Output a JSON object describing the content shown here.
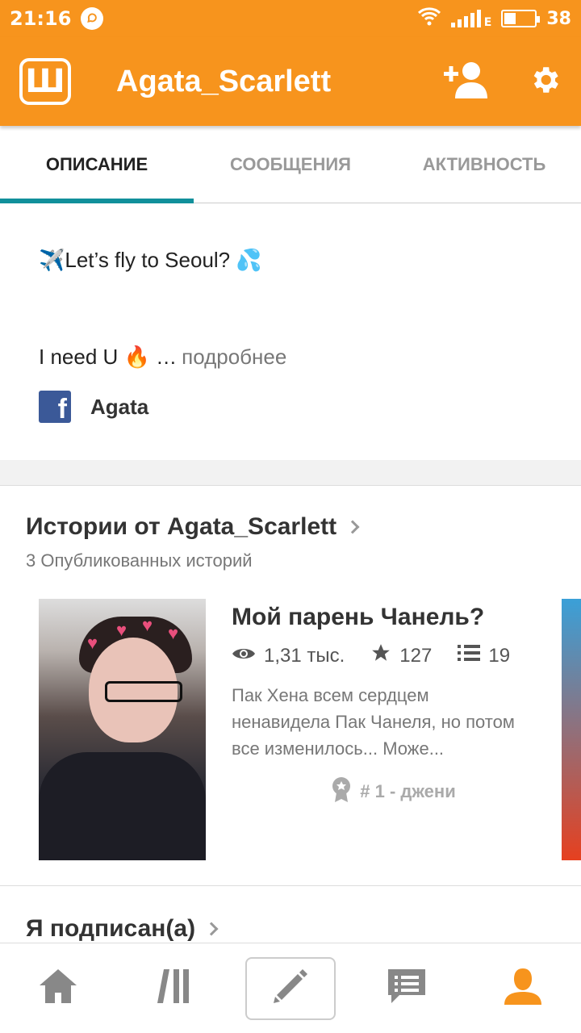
{
  "status": {
    "time": "21:16",
    "battery": "38",
    "network": "E",
    "battery_level": 0.38
  },
  "header": {
    "title": "Agata_Scarlett",
    "logo_letter": "Ш",
    "icons": [
      "add-user-icon",
      "gear-icon"
    ]
  },
  "tabs": [
    {
      "label": "ОПИСАНИЕ",
      "active": true
    },
    {
      "label": "СООБЩЕНИЯ",
      "active": false
    },
    {
      "label": "АКТИВНОСТЬ",
      "active": false
    }
  ],
  "about": {
    "line1": "✈️Let’s fly to Seoul? 💦",
    "line2": "I need U 🔥 …",
    "more": "подробнее",
    "facebook_letter": "f",
    "facebook_name": "Agata"
  },
  "stories": {
    "title": "Истории от Agata_Scarlett",
    "subtitle": "3 Опубликованных историй",
    "items": [
      {
        "title": "Мой парень Чанель?",
        "reads": "1,31 тыс.",
        "votes": "127",
        "parts": "19",
        "blurb": "Пак Хена всем сердцем ненавидела Пак Чанеля, но потом все изменилось... Може...",
        "rank": "# 1 - джени"
      }
    ]
  },
  "following": {
    "title": "Я подписан(а)"
  },
  "bottom_nav": [
    "home-icon",
    "library-icon",
    "write-icon",
    "messages-icon",
    "profile-icon"
  ],
  "colors": {
    "brand": "#f7941d",
    "tab_indicator": "#11909b",
    "facebook": "#3b5998"
  }
}
